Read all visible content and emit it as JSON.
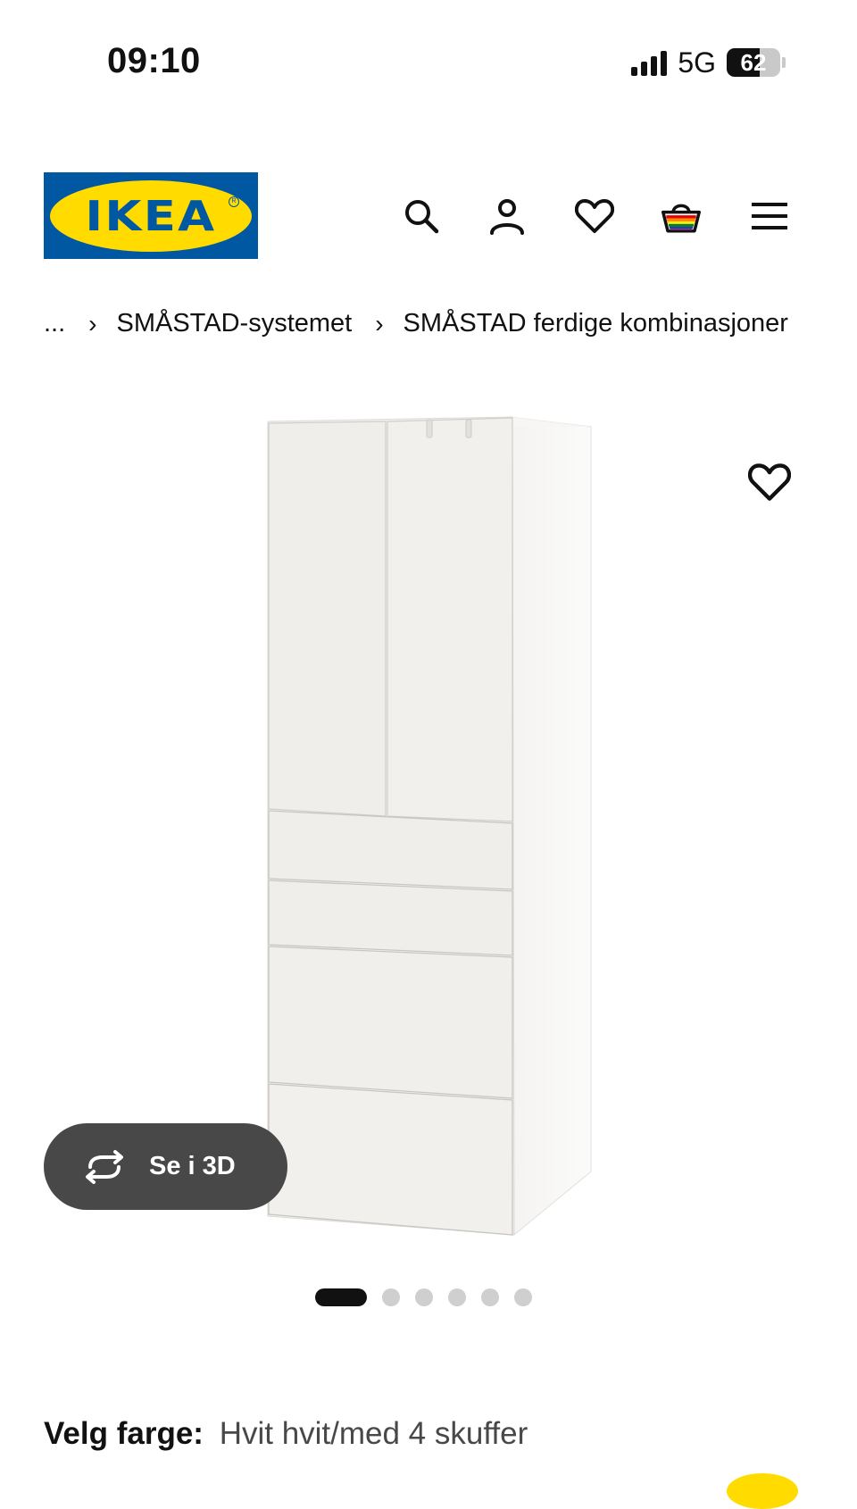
{
  "status_bar": {
    "time": "09:10",
    "network": "5G",
    "battery": "62",
    "battery_level": 0.62
  },
  "header": {
    "logo_text": "IKEA",
    "icons": [
      "search-icon",
      "user-icon",
      "heart-icon",
      "basket-icon",
      "menu-icon"
    ],
    "colors": {
      "brand_blue": "#0058a3",
      "brand_yellow": "#ffdb00"
    }
  },
  "breadcrumb": {
    "ellipsis": "...",
    "items": [
      "SMÅSTAD-systemet",
      "SMÅSTAD ferdige kombinasjoner"
    ]
  },
  "product": {
    "view3d_label": "Se i 3D",
    "carousel": {
      "count": 6,
      "active_index": 0
    }
  },
  "color_select": {
    "label": "Velg farge:",
    "value": "Hvit hvit/med 4 skuffer"
  }
}
